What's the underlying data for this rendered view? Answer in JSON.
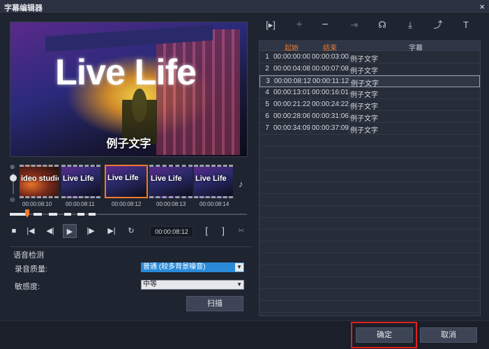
{
  "window": {
    "title": "字幕编辑器",
    "close_glyph": "×"
  },
  "preview": {
    "big_title": "Live Life",
    "subtitle": "例子文字"
  },
  "filmstrip": {
    "frames": [
      {
        "label": "ideo studio"
      },
      {
        "label": "Live Life"
      },
      {
        "label": "Live Life"
      },
      {
        "label": "Live Life"
      },
      {
        "label": "Live Life"
      }
    ],
    "timecodes": [
      "00:00:08:10",
      "00:00:08:11",
      "00:00:08:12",
      "00:00:08:13",
      "00:00:08:14"
    ],
    "zoom_in": "⊕",
    "zoom_out": "⊖"
  },
  "transport": {
    "timecode": "00:00:08:12"
  },
  "voice_detection": {
    "group_title": "语音检测",
    "quality_label": "录音质量:",
    "quality_value": "普通 (较多背景噪音)",
    "sensitivity_label": "敏感度:",
    "sensitivity_value": "中等",
    "scan_button": "扫描"
  },
  "table": {
    "headers": {
      "start": "起始",
      "end": "结束",
      "subtitle": "字幕"
    },
    "rows": [
      {
        "n": "1",
        "start": "00:00:00:00",
        "end": "00:00:03:00",
        "text": "例子文字"
      },
      {
        "n": "2",
        "start": "00:00:04:08",
        "end": "00:00:07:08",
        "text": "例子文字"
      },
      {
        "n": "3",
        "start": "00:00:08:12",
        "end": "00:00:11:12",
        "text": "例子文字"
      },
      {
        "n": "4",
        "start": "00:00:13:01",
        "end": "00:00:16:01",
        "text": "例子文字"
      },
      {
        "n": "5",
        "start": "00:00:21:22",
        "end": "00:00:24:22",
        "text": "例子文字"
      },
      {
        "n": "6",
        "start": "00:00:28:06",
        "end": "00:00:31:06",
        "text": "例子文字"
      },
      {
        "n": "7",
        "start": "00:00:34:09",
        "end": "00:00:37:09",
        "text": "例子文字"
      }
    ],
    "selected_row": 3
  },
  "buttons": {
    "ok": "确定",
    "cancel": "取消"
  },
  "colors": {
    "accent": "#f07a30",
    "highlight_border": "#e02020",
    "select_active": "#2a8ad8"
  }
}
